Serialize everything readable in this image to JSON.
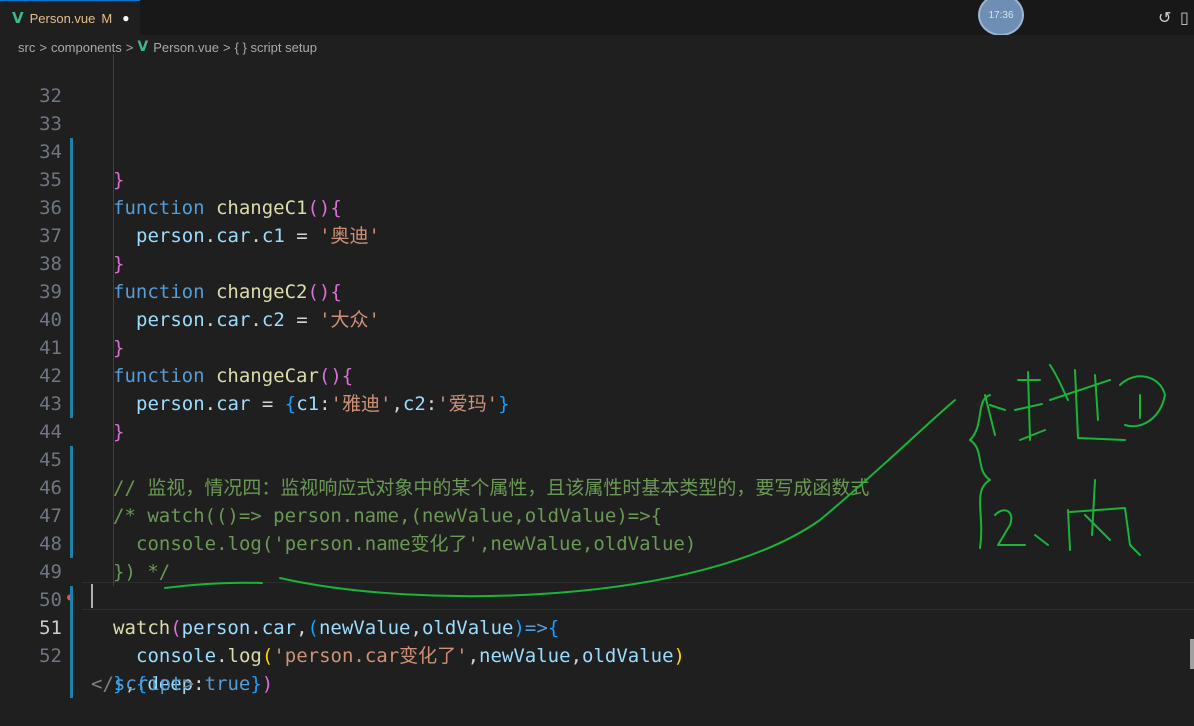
{
  "tab": {
    "filename": "Person.vue",
    "status": "M",
    "dot": "●"
  },
  "timer": {
    "label": "17:36"
  },
  "breadcrumb": {
    "src": "src",
    "components": "components",
    "file": "Person.vue",
    "symbol": "{ } script setup",
    "sep": ">"
  },
  "editor": {
    "lines": [
      {
        "n": "32",
        "t": [
          "}"
        ]
      },
      {
        "n": "33",
        "t": [
          "function",
          " changeC1",
          "()",
          "{"
        ]
      },
      {
        "n": "34",
        "t": [
          "person",
          ".",
          "car",
          ".",
          "c1",
          " = ",
          "'奥迪'"
        ]
      },
      {
        "n": "35",
        "t": [
          "}"
        ]
      },
      {
        "n": "36",
        "t": [
          "function",
          " changeC2",
          "()",
          "{"
        ]
      },
      {
        "n": "37",
        "t": [
          "person",
          ".",
          "car",
          ".",
          "c2",
          " = ",
          "'大众'"
        ]
      },
      {
        "n": "38",
        "t": [
          "}"
        ]
      },
      {
        "n": "39",
        "t": [
          "function",
          " changeCar",
          "()",
          "{"
        ]
      },
      {
        "n": "40",
        "t": [
          "person",
          ".",
          "car",
          " = ",
          "{",
          "c1",
          ":",
          "'雅迪'",
          ",",
          "c2",
          ":",
          "'爱玛'",
          "}"
        ]
      },
      {
        "n": "41",
        "t": [
          "}"
        ]
      },
      {
        "n": "42",
        "t": []
      },
      {
        "n": "43",
        "t": [
          "// 监视，情况四：监视响应式对象中的某个属性，且该属性时基本类型的，要写成函数式"
        ]
      },
      {
        "n": "44",
        "t": [
          "/* watch(()=> person.name,(newValue,oldValue)=>{"
        ]
      },
      {
        "n": "45",
        "t": [
          "console.log('person.name变化了',newValue,oldValue)"
        ]
      },
      {
        "n": "46",
        "t": [
          "}) */"
        ]
      },
      {
        "n": "47",
        "t": []
      },
      {
        "n": "48",
        "t": [
          "watch",
          "(",
          "person",
          ".",
          "car",
          ",",
          "(",
          "newValue",
          ",",
          "oldValue",
          ")",
          "=>",
          "{"
        ]
      },
      {
        "n": "49",
        "t": [
          "console",
          ".",
          "log",
          "(",
          "'person.car变化了'",
          ",",
          "newValue",
          ",",
          "oldValue",
          ")"
        ]
      },
      {
        "n": "50",
        "t": [
          "}",
          ",",
          "{",
          "deep",
          ":",
          "true",
          "}",
          ")"
        ]
      },
      {
        "n": "51",
        "t": []
      },
      {
        "n": "52",
        "t": [
          "</",
          "script",
          ">"
        ]
      }
    ]
  },
  "colors": {
    "keyword": "#569cd6",
    "function": "#dcdcaa",
    "variable": "#9cdcfe",
    "string": "#ce9178",
    "comment": "#6a9955",
    "bracket1": "#ffd700",
    "bracket2": "#da70d6",
    "bracket3": "#179fff",
    "ink": "#19b43a",
    "vue": "#41b883"
  },
  "icons": [
    "vue-logo-icon",
    "history-icon",
    "split-editor-icon",
    "error-marker-icon"
  ]
}
